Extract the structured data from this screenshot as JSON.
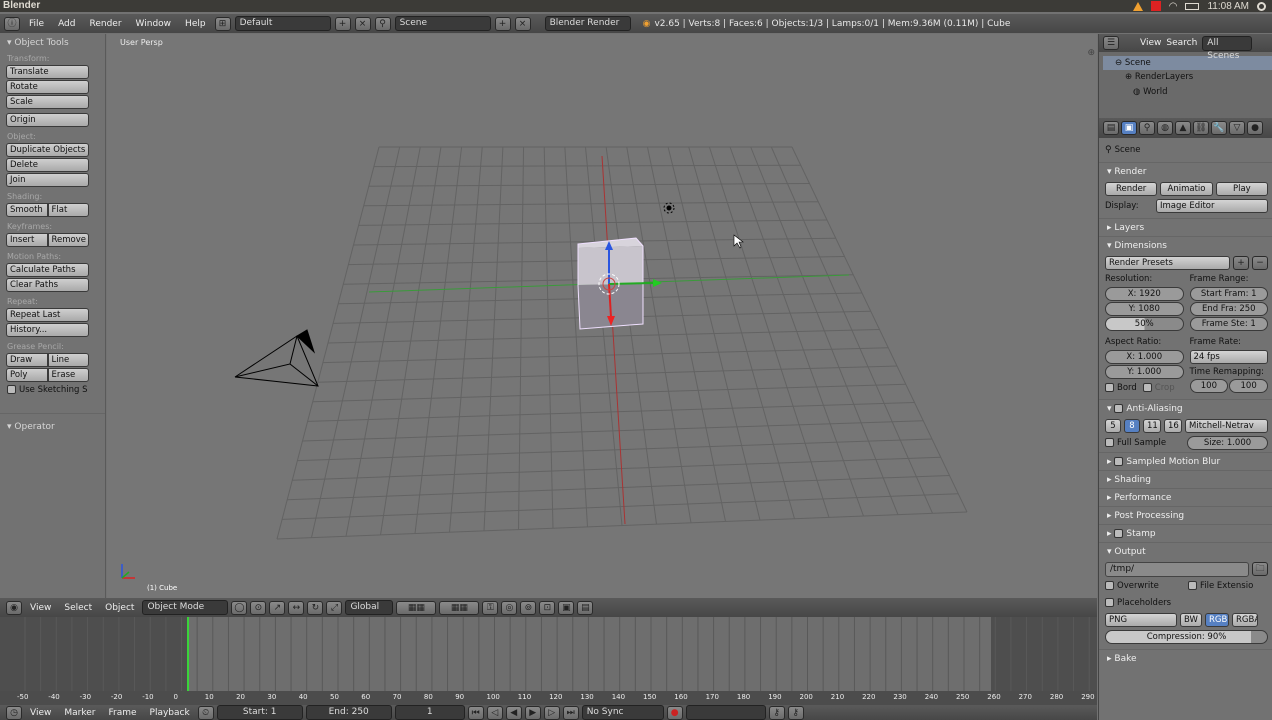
{
  "system": {
    "app_name": "Blender",
    "clock": "11:08 AM"
  },
  "infobar": {
    "menus": [
      "File",
      "Add",
      "Render",
      "Window",
      "Help"
    ],
    "layout": "Default",
    "scene": "Scene",
    "engine": "Blender Render",
    "stats": "v2.65 | Verts:8 | Faces:6 | Objects:1/3 | Lamps:0/1 | Mem:9.36M (0.11M) | Cube"
  },
  "toolshelf": {
    "title": "Object Tools",
    "transform_label": "Transform:",
    "translate": "Translate",
    "rotate": "Rotate",
    "scale": "Scale",
    "origin": "Origin",
    "object_label": "Object:",
    "duplicate": "Duplicate Objects",
    "delete": "Delete",
    "join": "Join",
    "shading_label": "Shading:",
    "smooth": "Smooth",
    "flat": "Flat",
    "keyframes_label": "Keyframes:",
    "insert": "Insert",
    "remove": "Remove",
    "motion_label": "Motion Paths:",
    "calc_paths": "Calculate Paths",
    "clear_paths": "Clear Paths",
    "repeat_label": "Repeat:",
    "repeat_last": "Repeat Last",
    "history": "History...",
    "grease_label": "Grease Pencil:",
    "draw": "Draw",
    "line": "Line",
    "poly": "Poly",
    "erase": "Erase",
    "use_sketching": "Use Sketching S",
    "operator": "Operator"
  },
  "viewport": {
    "view_label": "User Persp",
    "object_label": "(1) Cube"
  },
  "header3d": {
    "view": "View",
    "select": "Select",
    "object": "Object",
    "mode": "Object Mode",
    "orientation": "Global"
  },
  "timeline": {
    "ruler": [
      "-50",
      "-40",
      "-30",
      "-20",
      "-10",
      "0",
      "10",
      "20",
      "30",
      "40",
      "50",
      "60",
      "70",
      "80",
      "90",
      "100",
      "110",
      "120",
      "130",
      "140",
      "150",
      "160",
      "170",
      "180",
      "190",
      "200",
      "210",
      "220",
      "230",
      "240",
      "250",
      "260",
      "270",
      "280",
      "290"
    ],
    "view": "View",
    "marker": "Marker",
    "frame": "Frame",
    "playback": "Playback",
    "start": "Start: 1",
    "end": "End: 250",
    "current": "1",
    "sync": "No Sync"
  },
  "outliner": {
    "view": "View",
    "search": "Search",
    "filter": "All Scenes",
    "items": [
      "Scene",
      "RenderLayers",
      "World"
    ]
  },
  "properties": {
    "context": "Scene",
    "render": "Render",
    "render_btn": "Render",
    "anim_btn": "Animatio",
    "play_btn": "Play",
    "display_label": "Display:",
    "display_value": "Image Editor",
    "layers": "Layers",
    "dimensions": "Dimensions",
    "render_presets": "Render Presets",
    "resolution": "Resolution:",
    "res_x": "X: 1920",
    "res_y": "Y: 1080",
    "res_pct": "50%",
    "frame_range": "Frame Range:",
    "start_frame": "Start Fram: 1",
    "end_frame": "End Fra: 250",
    "frame_step": "Frame Ste: 1",
    "aspect": "Aspect Ratio:",
    "aspect_x": "X: 1.000",
    "aspect_y": "Y: 1.000",
    "frame_rate": "Frame Rate:",
    "fps": "24 fps",
    "time_remap": "Time Remapping:",
    "remap_old": "100",
    "remap_new": "100",
    "bord": "Bord",
    "crop": "Crop",
    "aa": "Anti-Aliasing",
    "aa_samples": [
      "5",
      "8",
      "11",
      "16"
    ],
    "aa_filter": "Mitchell-Netrav",
    "full_sample": "Full Sample",
    "size": "Size: 1.000",
    "motion_blur": "Sampled Motion Blur",
    "shading": "Shading",
    "performance": "Performance",
    "post": "Post Processing",
    "stamp": "Stamp",
    "output": "Output",
    "path": "/tmp/",
    "overwrite": "Overwrite",
    "file_ext": "File Extensio",
    "placeholders": "Placeholders",
    "format": "PNG",
    "bw": "BW",
    "rgb": "RGB",
    "rgba": "RGBA",
    "compression": "Compression: 90%",
    "bake": "Bake"
  }
}
